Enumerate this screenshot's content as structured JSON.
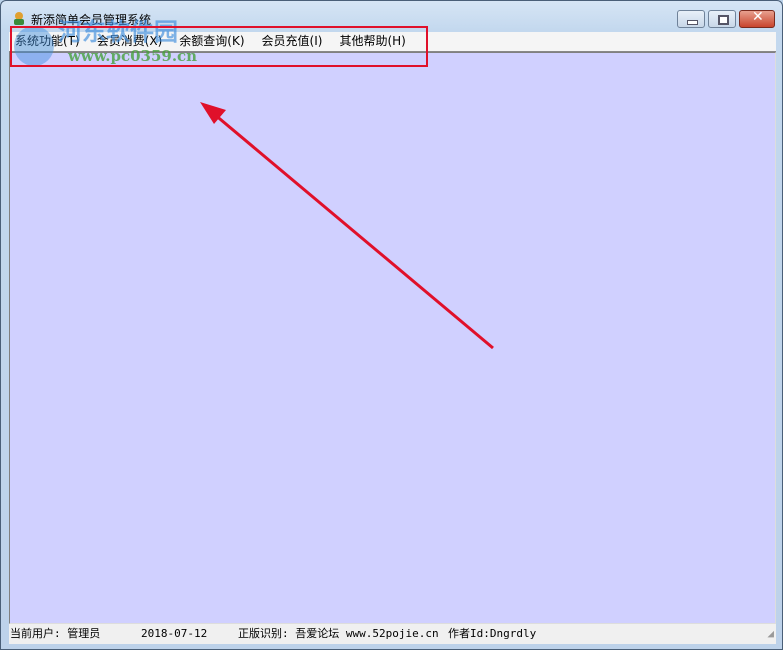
{
  "window": {
    "title": "新添简单会员管理系统",
    "controls": [
      "minimize",
      "maximize",
      "close"
    ]
  },
  "menu": [
    {
      "label": "系统功能(T)"
    },
    {
      "label": "会员消费(X)"
    },
    {
      "label": "余额查询(K)"
    },
    {
      "label": "会员充值(I)"
    },
    {
      "label": "其他帮助(H)"
    }
  ],
  "status": {
    "user": "当前用户: 管理员",
    "date": "2018-07-12",
    "license": "正版识别: 吾爱论坛 www.52pojie.cn",
    "author": "作者Id:Dngrdly"
  },
  "watermark": {
    "name": "河东软件园",
    "url": "www.pc0359.cn"
  },
  "annotation": {
    "color": "#e0102a"
  }
}
